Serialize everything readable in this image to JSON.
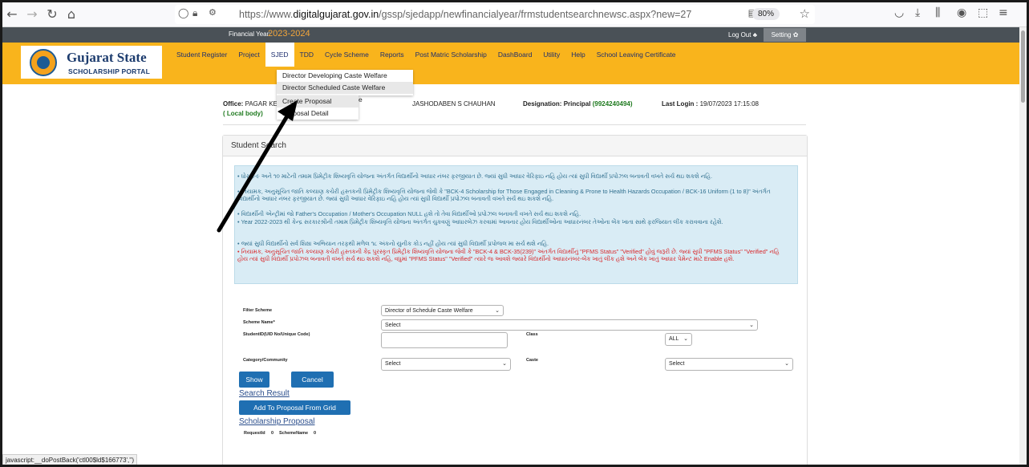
{
  "browser": {
    "url_prefix": "https://www.",
    "url_domain": "digitalgujarat.gov.in",
    "url_path": "/gssp/sjedapp/newfinancialyear/frmstudentsearchnewsc.aspx?new=27",
    "zoom": "80%"
  },
  "topbar": {
    "fy_label": "Financial Year:",
    "fy_value": "2023-2024",
    "logout": "Log Out ♣",
    "setting": "Setting ✿"
  },
  "logo": {
    "title": "Gujarat State",
    "subtitle": "SCHOLARSHIP PORTAL"
  },
  "menu": [
    {
      "label": "Student Register"
    },
    {
      "label": "Project"
    },
    {
      "label": "SJED"
    },
    {
      "label": "TDD"
    },
    {
      "label": "Cycle Scheme"
    },
    {
      "label": "Reports"
    },
    {
      "label": "Post Matric Scholarship"
    },
    {
      "label": "DashBoard"
    },
    {
      "label": "Utility"
    },
    {
      "label": "Help"
    },
    {
      "label": "School Leaving Certificate"
    }
  ],
  "dropdown": {
    "items": [
      "Director Developing Caste Welfare",
      "Director Scheduled Caste Welfare"
    ],
    "sub_items": [
      "Create Proposal",
      "Proposal Detail"
    ],
    "partial": "e"
  },
  "info": {
    "office_label": "Office:",
    "office_value": "PAGAR KE",
    "local_body": "( Local body)",
    "name_value": "JASHODABEN S CHAUHAN",
    "designation_label": "Designation:",
    "designation_value": "Principal",
    "designation_phone": "(9924240494)",
    "last_login_label": "Last Login :",
    "last_login_value": "19/07/2023 17:15:08"
  },
  "panel": {
    "title": "Student Search"
  },
  "notice": [
    {
      "text": "• ધોરણ-૯ અને ૧૦ માટેની તમામ પ્રિમેટ્રીક શિષ્યવૃત્તિ યોજના અંતર્ગત વિદ્યાર્થીનો આધાર નંબર ફરજીયાત છે. જ્યાં સુધી આધાર વેરિફાઇ નહિ હોય ત્યાં સુધી વિદ્યાર્થી પ્રપોઝલ બનાવતી વખતે સર્ચ થઇ શકશે નહિ.",
      "color": "blue"
    },
    {
      "text": "• નિયામક, અનુસૂચિત જાતિ કલ્યાણ કચેરી હસ્તકની પ્રિમેટ્રીક શિષ્યવૃત્તિ યોજના જેવી કે \"BCK-4 Scholarship for Those Engaged in Cleaning & Prone to Health Hazards Occupation / BCK-16 Uniform (1 to 8)\" અંતર્ગત વિદ્યાર્થીનો આધાર નંબર ફરજીયાત છે. જ્યાં સુધી આધાર વેરિફાઇ નહિ હોય ત્યાં સુધી વિદ્યાર્થી પ્રપોઝલ બનાવતી વખતે સર્ચ થઇ શકશે નહિ.",
      "color": "blue"
    },
    {
      "text": "• વિદ્યાર્થીની એન્ટ્રીમાં જો Father's Occupation / Mother's Occupation NULL હશે તો તેવા વિદ્યાર્થીઓ પ્રપોઝલ બનાવતી વખતે સર્ચ થઇ શકશે નહિ.",
      "color": "blue"
    },
    {
      "text": "• Year 2022-2023 થી કેન્દ્ર સરકારશ્રીની તમામ પ્રિમેટ્રીક શિષ્યવૃત્તિ યોજના અંતર્ગત ચુકવણું આધારબેઝ કરવામાં આવનાર હોય વિદ્યાર્થીઓના આધારનંબર તેઓના બેંક ખાતા સાથે ફરજિયાત લીંક કરાવવાના રહેશે.",
      "color": "blue"
    },
    {
      "text": "• જ્યાં સુધી વિદ્યાર્થીનો સર્વ શિક્ષા અભિયાન તરફથી મળેલ ૧૮ અંકનો યુનીક કોડ નહીં હોય ત્યાં સુધી વિદ્યાર્થી પ્રપોજલ મા સર્ચ થશે નહિ.",
      "color": "blue"
    },
    {
      "text": "• નિયામક, અનુસૂચિત જાતિ કલ્યાણ કચેરી હસ્તકની કેંદ્ર પુરસ્કૃત પ્રિમેટ્રીક શિષ્યવૃત્તિ યોજના જેવી કે \"BCK-4 & BCK-35(239)\" અંતર્ગત વિદ્યાર્થીનું \"PFMS Status\" \"Verified\" હોવું જરૂરી છે. જ્યાં સુધી \"PFMS Status\" \"Verified\" નહિ હોય ત્યાં સુધી વિદ્યાર્થી પ્રપોઝલ બનાવતી વખતે સર્ચ થઇ શકશે નહિ, વધુમાં \"PFMS Status\" \"Verified\" ત્યારે જ આવશે જ્યારે વિદ્યાર્થીનો આધારનંબર-બેંક ખાતું લીંક હશે અને બેંક ખાતું આધાર પેમેન્ટ માટે Enable હશે.",
      "color": "red"
    }
  ],
  "form": {
    "filter_scheme_label": "Filter Scheme",
    "filter_scheme_value": "Director of Schedule Caste Welfare",
    "scheme_name_label": "Scheme Name*",
    "scheme_name_value": "Select",
    "student_id_label": "StudentID(UID No/Unique Code)",
    "class_label": "Class",
    "class_value": "ALL",
    "category_label": "Category/Community",
    "category_value": "Select",
    "caste_label": "Caste",
    "caste_value": "Select"
  },
  "buttons": {
    "show": "Show",
    "cancel": "Cancel",
    "add_grid": "Add To Proposal From Grid"
  },
  "links": {
    "search_result": "Search Result",
    "scholarship_proposal": "Scholarship Proposal"
  },
  "proposal": {
    "request_label": "RequestId",
    "request_value": "0",
    "scheme_label": "SchemeName",
    "scheme_value": "0"
  },
  "status_bar": "javascript:__doPostBack('ctl00$ld$166773','')"
}
